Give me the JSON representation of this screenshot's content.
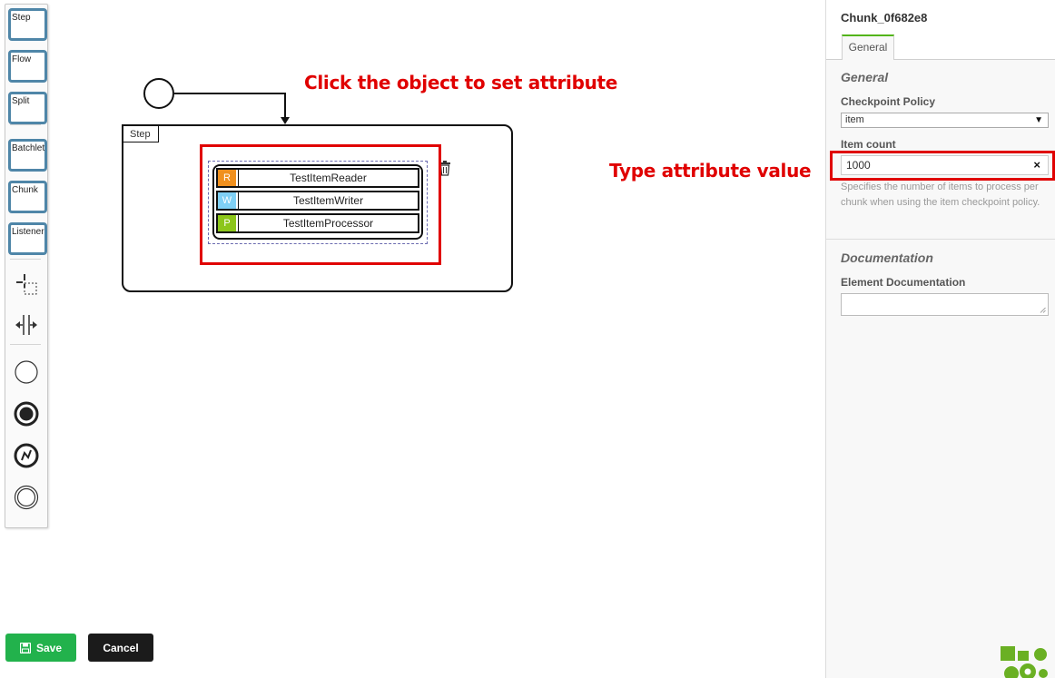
{
  "palette": {
    "items": [
      {
        "label": "Step"
      },
      {
        "label": "Flow"
      },
      {
        "label": "Split"
      },
      {
        "label": "Batchlet"
      },
      {
        "label": "Chunk"
      },
      {
        "label": "Listener"
      }
    ],
    "tools": [
      "lasso-tool-icon",
      "space-tool-icon"
    ],
    "events": [
      "start-event-icon",
      "end-event-icon",
      "error-event-icon",
      "intermediate-event-icon"
    ]
  },
  "canvas": {
    "step_label": "Step",
    "items": [
      {
        "badge": "R",
        "label": "TestItemReader",
        "color": "#f0901e"
      },
      {
        "badge": "W",
        "label": "TestItemWriter",
        "color": "#7fd0f5"
      },
      {
        "badge": "P",
        "label": "TestItemProcessor",
        "color": "#8cc61a"
      }
    ]
  },
  "annotations": {
    "click": "Click the object to set attribute",
    "type": "Type attribute value",
    "color": "#e00000"
  },
  "buttons": {
    "save": "Save",
    "cancel": "Cancel",
    "save_color": "#22b24c",
    "cancel_color": "#1b1b1b"
  },
  "panel": {
    "title": "Chunk_0f682e8",
    "tab": "General",
    "sections": {
      "general": "General",
      "documentation": "Documentation"
    },
    "checkpoint_policy": {
      "label": "Checkpoint Policy",
      "value": "item"
    },
    "item_count": {
      "label": "Item count",
      "value": "1000",
      "help": "Specifies the number of items to process per chunk when using the item checkpoint policy."
    },
    "element_documentation": {
      "label": "Element Documentation",
      "value": ""
    },
    "accent": "#52b415"
  }
}
